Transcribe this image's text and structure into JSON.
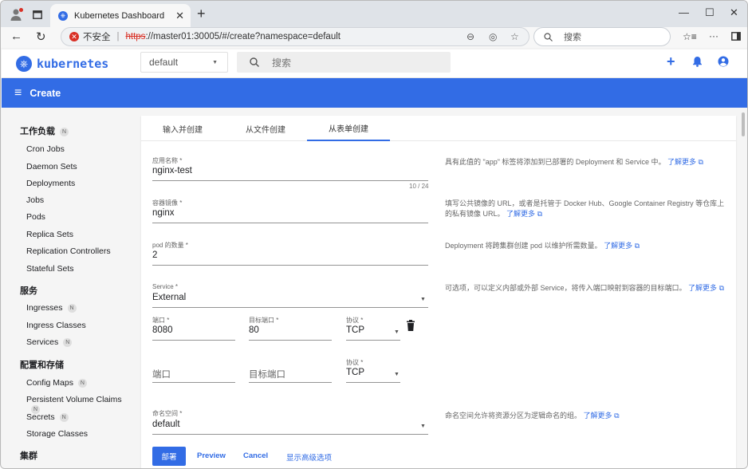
{
  "browser": {
    "tab_title": "Kubernetes Dashboard",
    "not_secure": "不安全",
    "url_scheme": "https",
    "url_rest": "://master01:30005/#/create?namespace=default",
    "search_placeholder": "搜索"
  },
  "header": {
    "logo_text": "kubernetes",
    "namespace": "default",
    "search_placeholder": "搜索"
  },
  "toolbar": {
    "title": "Create"
  },
  "sidebar": {
    "workloads": {
      "label": "工作负载",
      "badge": "N"
    },
    "workload_items": [
      "Cron Jobs",
      "Daemon Sets",
      "Deployments",
      "Jobs",
      "Pods",
      "Replica Sets",
      "Replication Controllers",
      "Stateful Sets"
    ],
    "services": {
      "label": "服务"
    },
    "service_items": [
      "Ingresses",
      "Ingress Classes",
      "Services"
    ],
    "service_badge": "N",
    "config": {
      "label": "配置和存储"
    },
    "config_items": [
      "Config Maps",
      "Persistent Volume Claims",
      "Secrets",
      "Storage Classes"
    ],
    "config_badge": "N",
    "cluster": {
      "label": "集群"
    }
  },
  "tabs": [
    "输入并创建",
    "从文件创建",
    "从表单创建"
  ],
  "form": {
    "app_name": {
      "label": "应用名称 *",
      "value": "nginx-test",
      "counter": "10 / 24",
      "hint": "具有此值的 \"app\" 标签将添加到已部署的 Deployment 和 Service 中。",
      "link": "了解更多"
    },
    "image": {
      "label": "容器镜像 *",
      "value": "nginx",
      "hint": "填写公共镜像的 URL，或者是托管于 Docker Hub、Google Container Registry 等仓库上的私有镜像 URL。",
      "link": "了解更多"
    },
    "pods": {
      "label": "pod 的数量 *",
      "value": "2",
      "hint": "Deployment 将跨集群创建 pod 以维护所需数量。",
      "link": "了解更多"
    },
    "service": {
      "label": "Service *",
      "value": "External",
      "hint": "可选项，可以定义内部或外部 Service，将传入端口映射到容器的目标端口。",
      "link": "了解更多"
    },
    "port1": {
      "port_label": "端口 *",
      "port_value": "8080",
      "target_label": "目标端口 *",
      "target_value": "80",
      "protocol_label": "协议 *",
      "protocol_value": "TCP"
    },
    "port2": {
      "port_placeholder": "端口",
      "target_placeholder": "目标端口",
      "protocol_label": "协议 *",
      "protocol_value": "TCP"
    },
    "namespace": {
      "label": "命名空间 *",
      "value": "default",
      "hint": "命名空间允许将资源分区为逻辑命名的组。",
      "link": "了解更多"
    }
  },
  "actions": {
    "deploy": "部署",
    "preview": "Preview",
    "cancel": "Cancel",
    "advanced": "显示高级选项"
  },
  "colors": {
    "accent": "#326ce5",
    "danger": "#d93025"
  }
}
